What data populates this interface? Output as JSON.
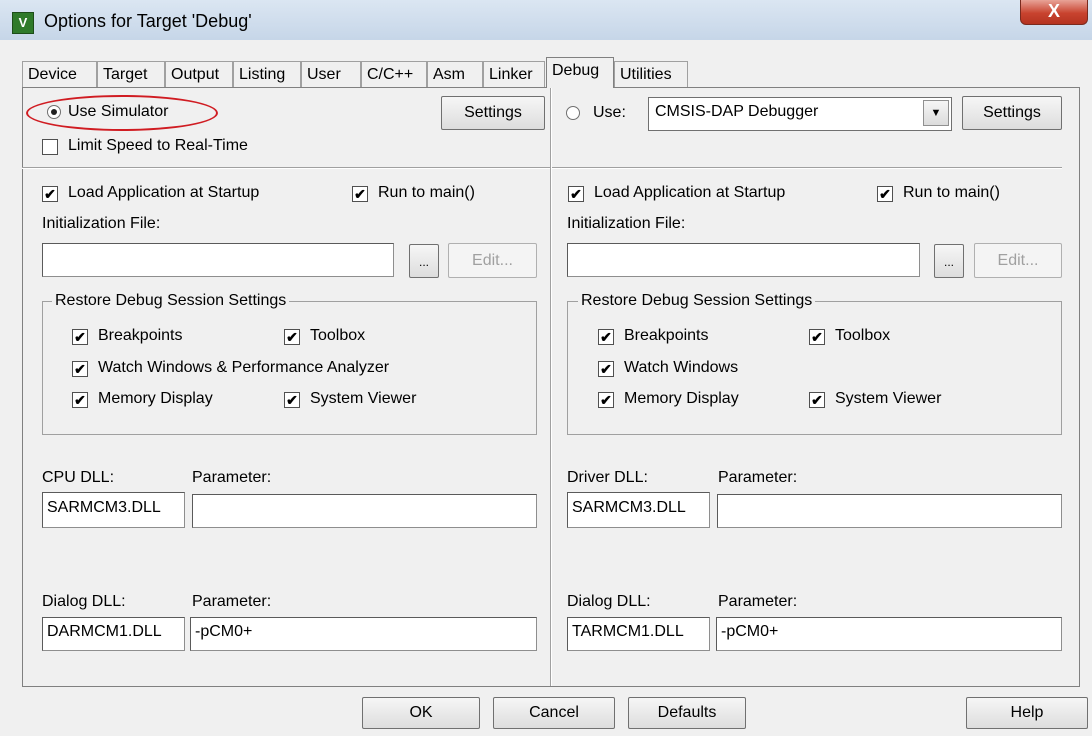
{
  "window": {
    "title": "Options for Target 'Debug'",
    "icon_glyph": "V",
    "close_glyph": "X"
  },
  "tabs": [
    "Device",
    "Target",
    "Output",
    "Listing",
    "User",
    "C/C++",
    "Asm",
    "Linker",
    "Debug",
    "Utilities"
  ],
  "active_tab": "Debug",
  "left": {
    "use_simulator": "Use Simulator",
    "settings": "Settings",
    "limit_speed": "Limit Speed to Real-Time",
    "load_app": "Load Application at Startup",
    "run_main": "Run to main()",
    "init_file": "Initialization File:",
    "init_value": "",
    "browse": "...",
    "edit": "Edit...",
    "restore_title": "Restore Debug Session Settings",
    "breakpoints": "Breakpoints",
    "toolbox": "Toolbox",
    "watch": "Watch Windows & Performance Analyzer",
    "memory": "Memory Display",
    "system_viewer": "System Viewer",
    "cpu_dll_label": "CPU DLL:",
    "cpu_param_label": "Parameter:",
    "cpu_dll": "SARMCM3.DLL",
    "cpu_param": "",
    "dialog_dll_label": "Dialog DLL:",
    "dialog_param_label": "Parameter:",
    "dialog_dll": "DARMCM1.DLL",
    "dialog_param": "-pCM0+"
  },
  "right": {
    "use": "Use:",
    "debugger": "CMSIS-DAP Debugger",
    "settings": "Settings",
    "load_app": "Load Application at Startup",
    "run_main": "Run to main()",
    "init_file": "Initialization File:",
    "init_value": "",
    "browse": "...",
    "edit": "Edit...",
    "restore_title": "Restore Debug Session Settings",
    "breakpoints": "Breakpoints",
    "toolbox": "Toolbox",
    "watch": "Watch Windows",
    "memory": "Memory Display",
    "system_viewer": "System Viewer",
    "driver_dll_label": "Driver DLL:",
    "driver_param_label": "Parameter:",
    "driver_dll": "SARMCM3.DLL",
    "driver_param": "",
    "dialog_dll_label": "Dialog DLL:",
    "dialog_param_label": "Parameter:",
    "dialog_dll": "TARMCM1.DLL",
    "dialog_param": "-pCM0+"
  },
  "buttons": {
    "ok": "OK",
    "cancel": "Cancel",
    "defaults": "Defaults",
    "help": "Help"
  },
  "check_glyph": "✔",
  "colors": {
    "highlight_ellipse": "#d01c22"
  }
}
